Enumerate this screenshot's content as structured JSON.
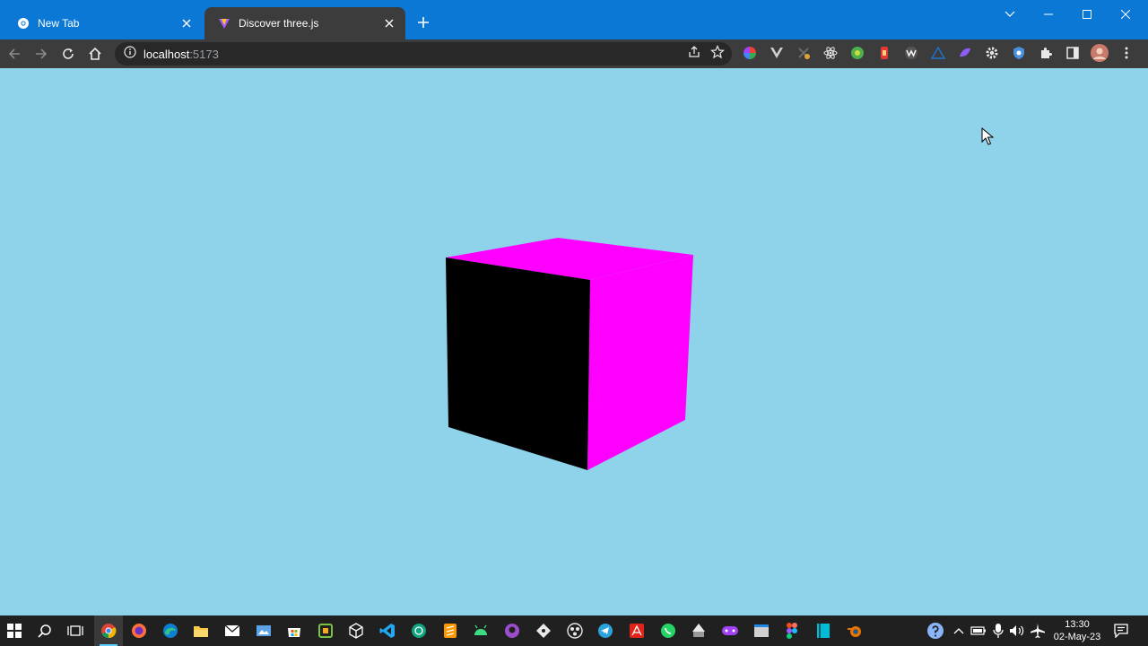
{
  "tabs": [
    {
      "title": "New Tab",
      "active": false
    },
    {
      "title": "Discover three.js",
      "active": true
    }
  ],
  "address_bar": {
    "host": "localhost",
    "port": ":5173"
  },
  "scene": {
    "background_color": "#8fd3eb",
    "cube_colors": {
      "top": "#ff00ff",
      "right": "#ff00ff",
      "front": "#000000"
    }
  },
  "taskbar": {
    "time": "13:30",
    "date": "02-May-23"
  },
  "colors": {
    "tabstrip": "#0a78d4",
    "toolbar": "#3c3c3c",
    "taskbar": "#202020",
    "accent": "#60cdff"
  }
}
